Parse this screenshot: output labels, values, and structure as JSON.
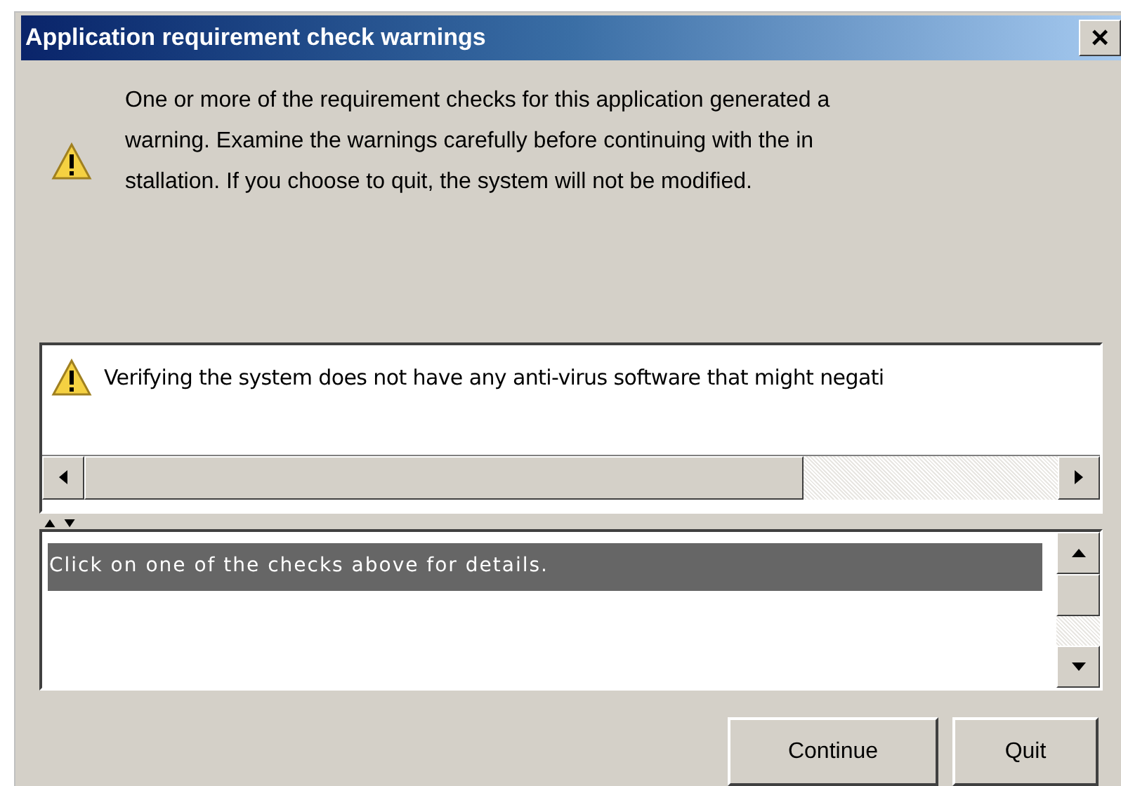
{
  "window": {
    "title": "Application requirement check warnings",
    "close_label": "×"
  },
  "message": {
    "lines": [
      "One or more of the requirement checks for this application generated a",
      "warning. Examine the warnings carefully before continuing with the in",
      "stallation. If you choose to quit, the system will not be modified."
    ]
  },
  "checks": [
    {
      "text": "Verifying the system does not have any anti-virus software that might negati"
    }
  ],
  "details": {
    "text": "Click on one of the checks above for details."
  },
  "buttons": [
    {
      "label": "Continue"
    },
    {
      "label": "Quit"
    }
  ]
}
